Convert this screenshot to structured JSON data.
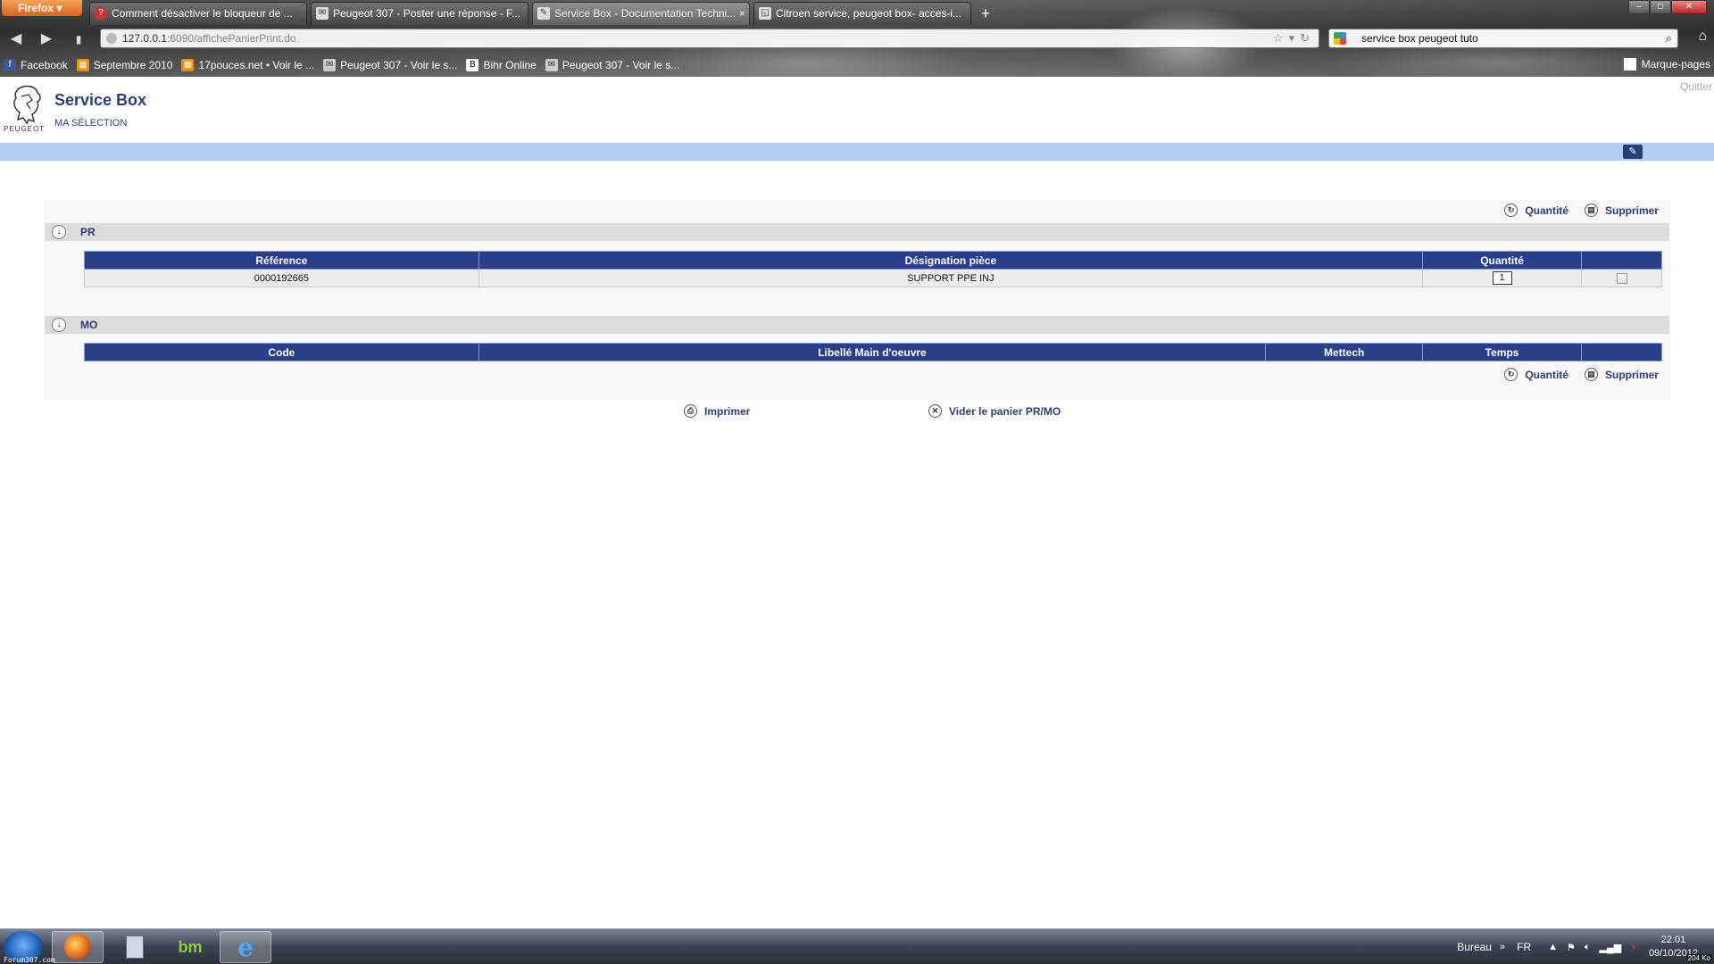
{
  "browser": {
    "menu_label": "Firefox",
    "tabs": [
      {
        "label": "Comment désactiver le bloqueur de ..."
      },
      {
        "label": "Peugeot 307 - Poster une réponse - F..."
      },
      {
        "label": "Service Box - Documentation Techni..."
      },
      {
        "label": "Citroen service, peugeot box- acces-i..."
      }
    ],
    "new_tab": "+",
    "url_host": "127.0.0.1",
    "url_rest": ":6090/affichePanierPrint.do",
    "search_value": "service box peugeot tuto",
    "bookmarks": [
      {
        "label": "Facebook",
        "color": "#3b5998"
      },
      {
        "label": "Septembre 2010",
        "color": "#f28c00"
      },
      {
        "label": "17pouces.net • Voir le ...",
        "color": "#f28c00"
      },
      {
        "label": "Peugeot 307 - Voir le s...",
        "color": "#cccccc"
      },
      {
        "label": "Bihr Online",
        "color": "#ffffff"
      },
      {
        "label": "Peugeot 307 - Voir le s...",
        "color": "#cccccc"
      }
    ],
    "bookmarks_menu": "Marque-pages"
  },
  "page": {
    "quit_label": "Quitter",
    "logo_text": "PEUGEOT",
    "title": "Service Box",
    "subtitle": "MA SÉLECTION",
    "actions": {
      "quantity": "Quantité",
      "delete": "Supprimer"
    },
    "sections": {
      "pr": {
        "title": "PR",
        "headers": [
          "Référence",
          "Désignation pièce",
          "Quantité",
          ""
        ],
        "rows": [
          {
            "reference": "0000192665",
            "designation": "SUPPORT PPE INJ",
            "quantity": "1"
          }
        ]
      },
      "mo": {
        "title": "MO",
        "headers": [
          "Code",
          "Libellé Main d'oeuvre",
          "Mettech",
          "Temps",
          ""
        ]
      }
    },
    "footer_links": {
      "print": "Imprimer",
      "empty_cart": "Vider le panier PR/MO"
    }
  },
  "taskbar": {
    "forum_tag": "Forum307.com",
    "apps": [
      "firefox",
      "calculator",
      "bm",
      "internet-explorer"
    ],
    "bm_label": "bm",
    "desktop_label": "Bureau",
    "language": "FR",
    "time": "22:01",
    "date": "09/10/2012",
    "net_rate": "204 Ko"
  },
  "colors": {
    "accent": "#2a3f8a",
    "bluebar": "#b4ccf2",
    "link": "#2a3f7a"
  }
}
